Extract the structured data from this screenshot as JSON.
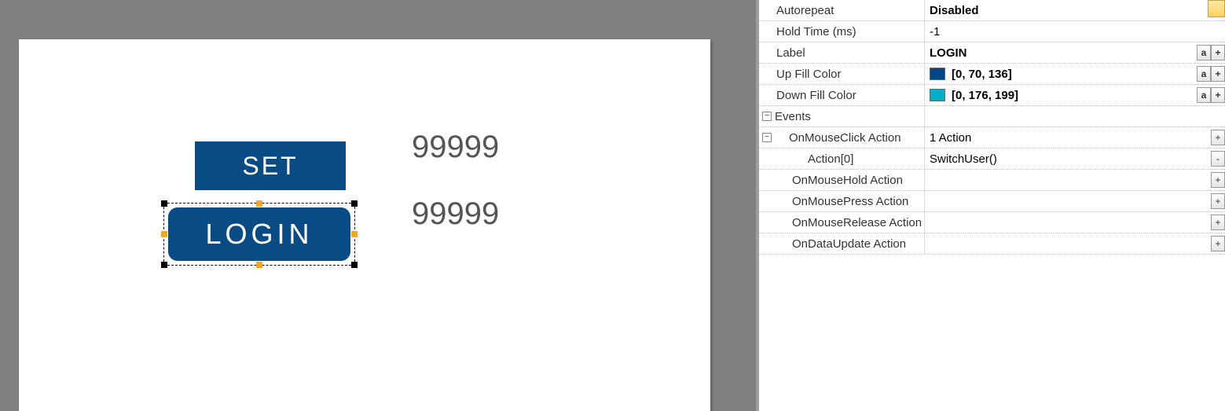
{
  "canvas": {
    "set_button_label": "SET",
    "login_button_label": "LOGIN",
    "value_display_1": "99999",
    "value_display_2": "99999"
  },
  "props": {
    "autorepeat": {
      "label": "Autorepeat",
      "value": "Disabled"
    },
    "hold_time": {
      "label": "Hold Time (ms)",
      "value": "-1"
    },
    "label_prop": {
      "label": "Label",
      "value": "LOGIN"
    },
    "up_fill": {
      "label": "Up Fill Color",
      "value": "[0, 70, 136]",
      "color": "#004688"
    },
    "down_fill": {
      "label": "Down Fill Color",
      "value": "[0, 176, 199]",
      "color": "#00b0c7"
    },
    "events_section": "Events",
    "on_mouse_click": {
      "label": "OnMouseClick Action",
      "value": "1 Action"
    },
    "action0": {
      "label": "Action[0]",
      "value": "SwitchUser()"
    },
    "on_mouse_hold": {
      "label": "OnMouseHold Action",
      "value": ""
    },
    "on_mouse_press": {
      "label": "OnMousePress Action",
      "value": ""
    },
    "on_mouse_release": {
      "label": "OnMouseRelease Action",
      "value": ""
    },
    "on_data_update": {
      "label": "OnDataUpdate Action",
      "value": ""
    }
  },
  "buttons": {
    "a": "a",
    "plus": "+",
    "minus": "-",
    "collapse": "−"
  }
}
